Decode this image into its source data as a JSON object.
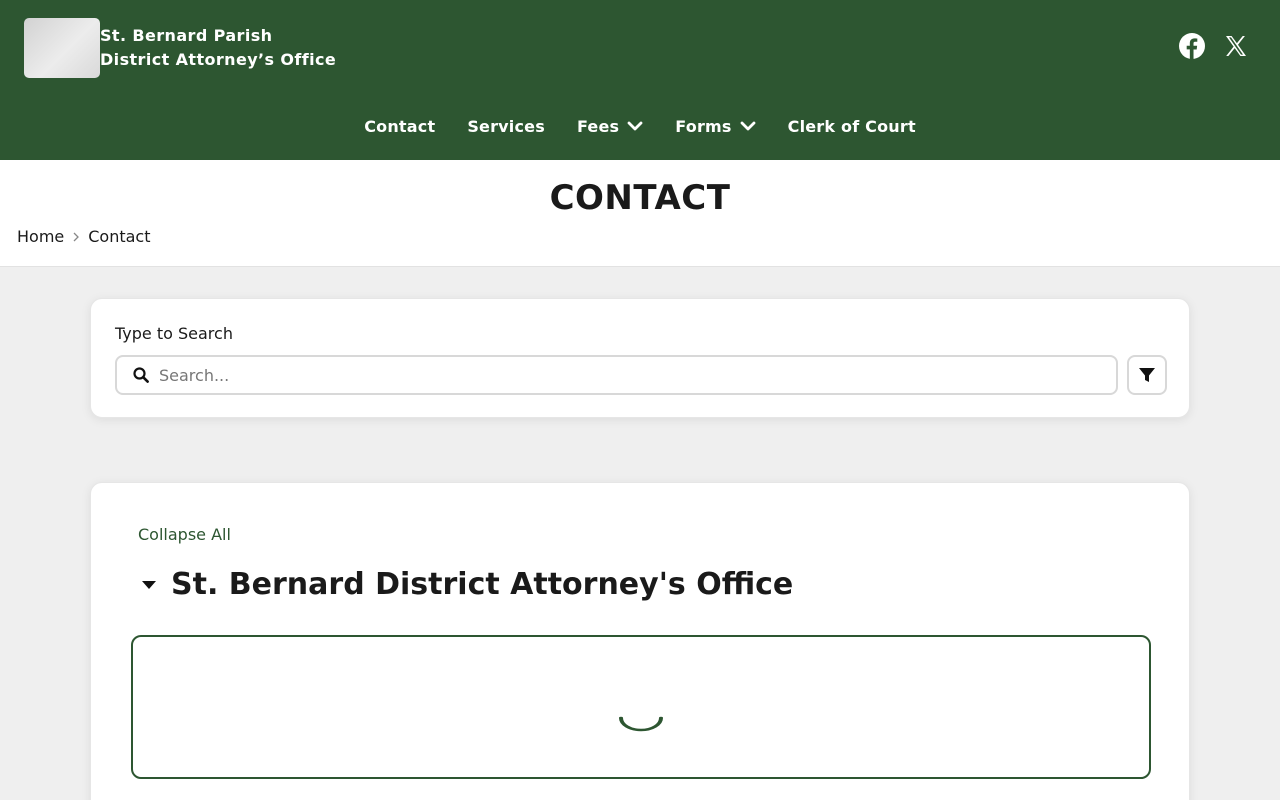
{
  "site": {
    "name_line1": "St. Bernard Parish",
    "name_line2": "District Attorney’s Office"
  },
  "social": [
    {
      "icon": "facebook-icon"
    },
    {
      "icon": "x-icon"
    }
  ],
  "nav": {
    "items": [
      {
        "label": "Contact"
      },
      {
        "label": "Services"
      },
      {
        "label": "Fees"
      },
      {
        "label": "Forms"
      },
      {
        "label": "Clerk of Court"
      }
    ]
  },
  "page": {
    "title": "CONTACT"
  },
  "breadcrumb": {
    "home": "Home",
    "current": "Contact"
  },
  "search": {
    "label": "Type to Search",
    "placeholder": "Search..."
  },
  "directory": {
    "collapse_label": "Collapse All",
    "section_title": "St. Bernard District Attorney's Office"
  },
  "colors": {
    "brand_green": "#2d5631",
    "background": "#efefef"
  }
}
